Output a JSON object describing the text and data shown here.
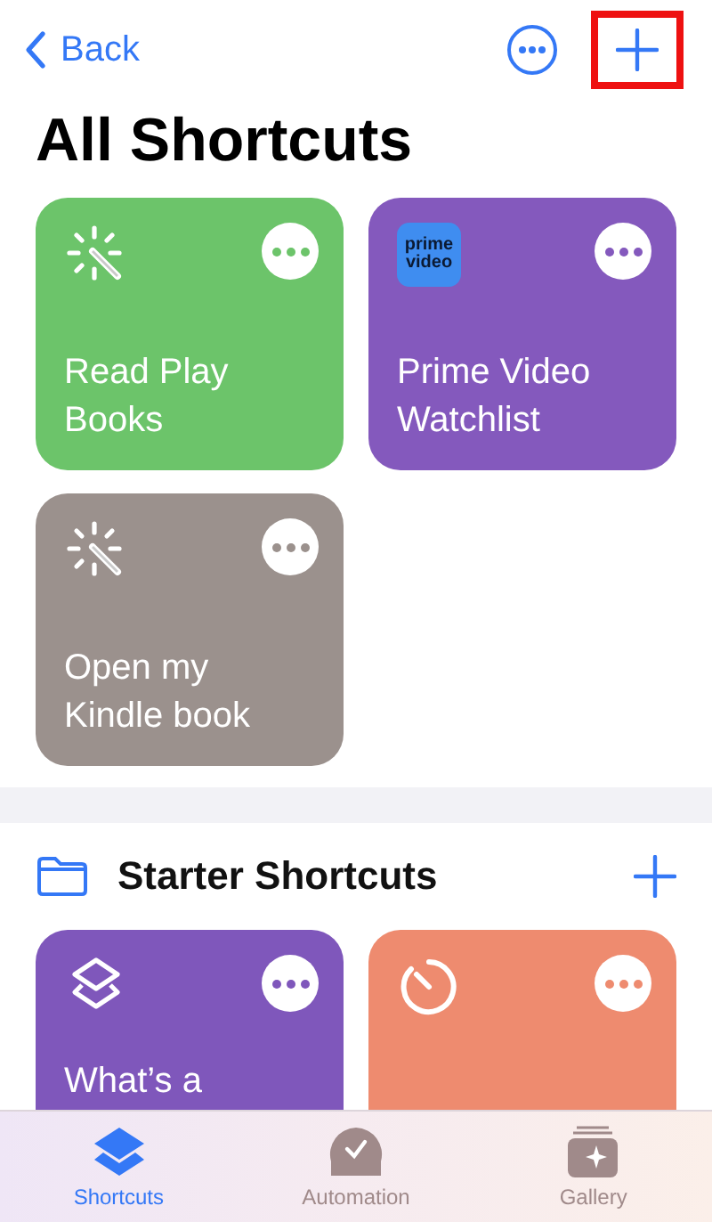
{
  "nav": {
    "back_label": "Back",
    "add_highlighted": true
  },
  "title": "All Shortcuts",
  "shortcuts": [
    {
      "name": "Read Play Books",
      "kind": "wand",
      "color": "#6cc46a"
    },
    {
      "name": "Prime Video Watchlist",
      "kind": "app",
      "icon_text": "prime video",
      "color": "#8459bd"
    },
    {
      "name": "Open my Kindle book",
      "kind": "wand",
      "color": "#9b918d"
    }
  ],
  "folder": {
    "title": "Starter Shortcuts",
    "shortcuts": [
      {
        "name": "What’s a",
        "kind": "layers",
        "color": "#7f57bb"
      },
      {
        "kind": "timer",
        "color": "#ee8b6f"
      }
    ]
  },
  "tabs": [
    {
      "label": "Shortcuts",
      "kind": "layers",
      "selected": true
    },
    {
      "label": "Automation",
      "kind": "clock",
      "selected": false
    },
    {
      "label": "Gallery",
      "kind": "gallery",
      "selected": false
    }
  ]
}
